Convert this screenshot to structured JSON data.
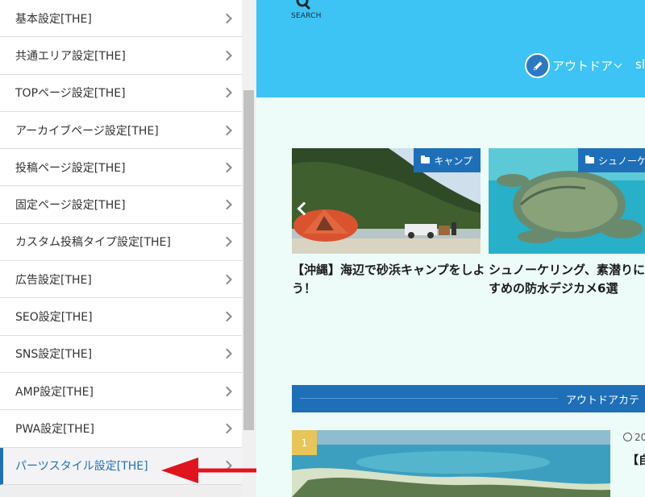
{
  "sidebar": {
    "items": [
      {
        "label": "基本設定[THE]"
      },
      {
        "label": "共通エリア設定[THE]"
      },
      {
        "label": "TOPページ設定[THE]"
      },
      {
        "label": "アーカイブページ設定[THE]"
      },
      {
        "label": "投稿ページ設定[THE]"
      },
      {
        "label": "固定ページ設定[THE]"
      },
      {
        "label": "カスタム投稿タイプ設定[THE]"
      },
      {
        "label": "広告設定[THE]"
      },
      {
        "label": "SEO設定[THE]"
      },
      {
        "label": "SNS設定[THE]"
      },
      {
        "label": "AMP設定[THE]"
      },
      {
        "label": "PWA設定[THE]"
      },
      {
        "label": "パーツスタイル設定[THE]"
      }
    ],
    "active_index": 12
  },
  "preview": {
    "search_label": "SEARCH",
    "nav_label": "アウトドア",
    "nav_extra": "sl",
    "cards": [
      {
        "category": "キャンプ",
        "title": "【沖縄】海辺で砂浜キャンプをしよう！"
      },
      {
        "category": "シュノーケ",
        "title": "シュノーケリング、素潜りにすめの防水デジカメ6選"
      }
    ],
    "section_title": "アウトドアカテ",
    "list": {
      "rank": "1",
      "date": "20",
      "title": "【自"
    }
  },
  "colors": {
    "header": "#3ec3f5",
    "accent": "#1e6fb8",
    "rank": "#e7c55a",
    "annotation_arrow": "#e0141e",
    "preview_bg": "#edfcf9"
  }
}
